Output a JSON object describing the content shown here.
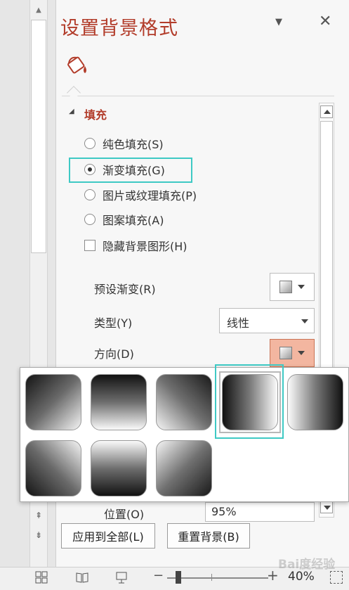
{
  "pane": {
    "title": "设置背景格式",
    "menu_glyph": "▼",
    "close_glyph": "✕",
    "tab_icon": "fill-bucket-icon"
  },
  "fill_section": {
    "caret": "◢",
    "label": "填充",
    "options": [
      {
        "label": "纯色填充(S)",
        "type": "radio",
        "selected": false
      },
      {
        "label": "渐变填充(G)",
        "type": "radio",
        "selected": true
      },
      {
        "label": "图片或纹理填充(P)",
        "type": "radio",
        "selected": false
      },
      {
        "label": "图案填充(A)",
        "type": "radio",
        "selected": false
      },
      {
        "label": "隐藏背景图形(H)",
        "type": "checkbox",
        "checked": false
      }
    ],
    "highlight_color": "#3ec9c4"
  },
  "gradient": {
    "preset_label": "预设渐变(R)",
    "type_label": "类型(Y)",
    "type_value": "线性",
    "direction_label": "方向(D)",
    "position_label": "位置(O)",
    "position_value": "95%"
  },
  "direction_gallery": {
    "selected_index": 3,
    "tiles": [
      "diagonal-top-left",
      "linear-down",
      "diagonal-top-right",
      "linear-right",
      "linear-left",
      "diagonal-bottom-left",
      "linear-up",
      "diagonal-bottom-right"
    ]
  },
  "buttons": {
    "apply_all": "应用到全部(L)",
    "reset": "重置背景(B)"
  },
  "statusbar": {
    "zoom_minus": "−",
    "zoom_plus": "+",
    "zoom_level": "40%",
    "watermark": "Bai度经验"
  },
  "nav": {
    "prev_glyph": "⇞",
    "next_glyph": "⇟"
  },
  "colors": {
    "title": "#b23c2a",
    "accent_teal": "#3ec9c4",
    "direction_button": "#f3b6a0"
  }
}
